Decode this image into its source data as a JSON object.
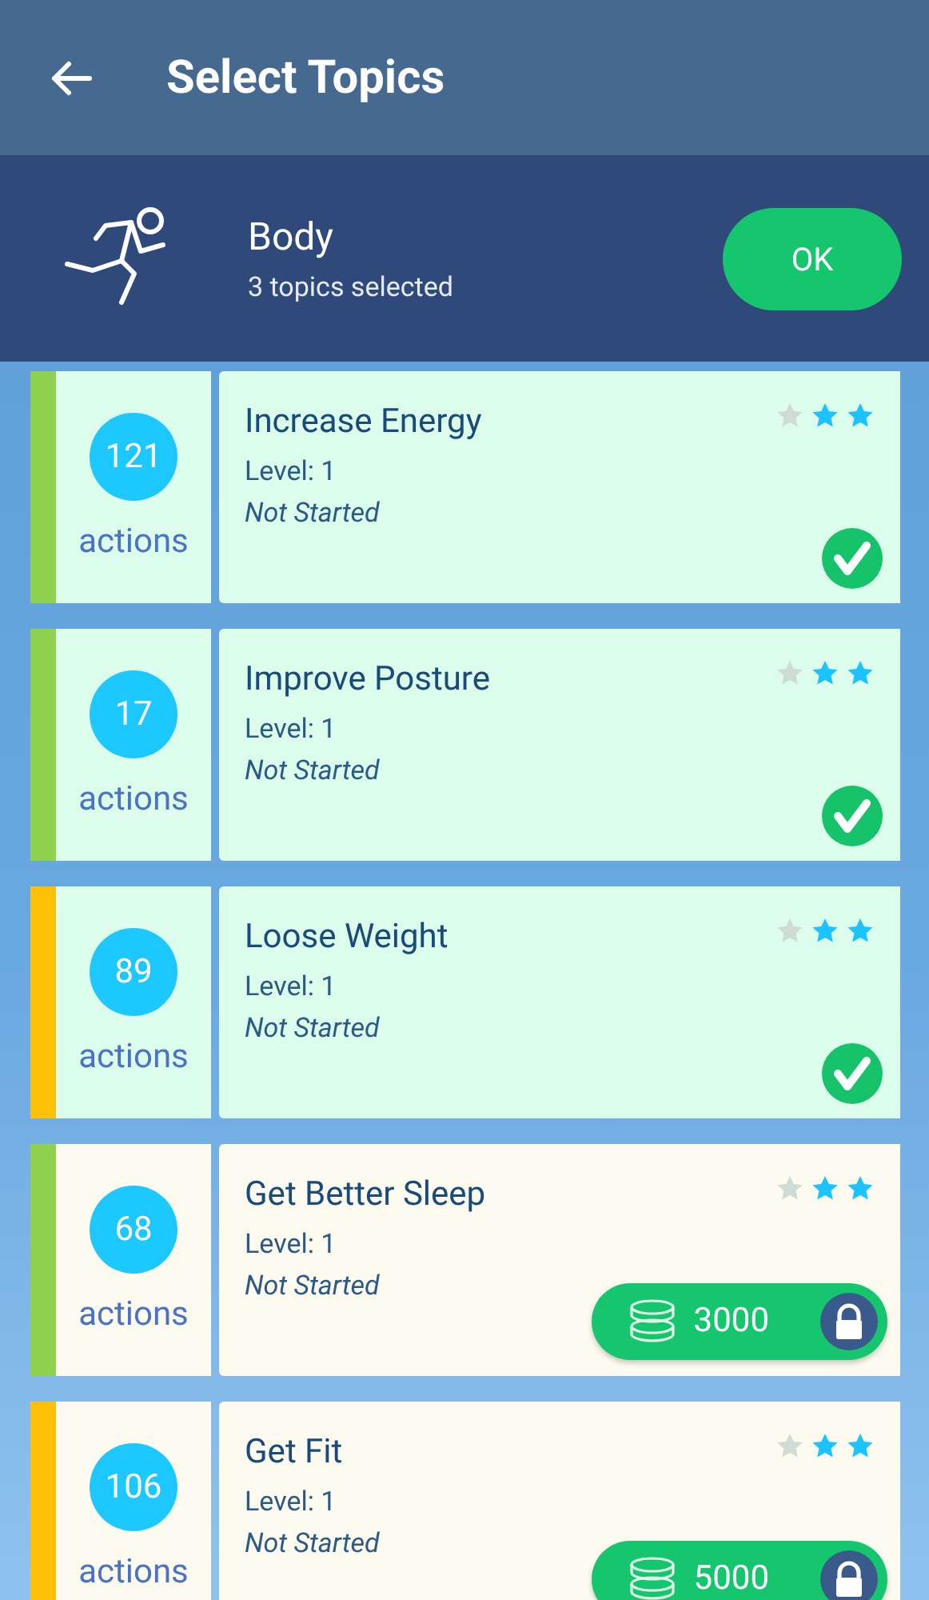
{
  "app_bar": {
    "title": "Select Topics"
  },
  "category": {
    "name": "Body",
    "subtitle": "3 topics selected",
    "button": "OK"
  },
  "topics": [
    {
      "count": "121",
      "count_label": "actions",
      "title": "Increase Energy",
      "level": "Level: 1",
      "status": "Not Started",
      "stars": 2,
      "color": "#8fd14f",
      "kind": "selected"
    },
    {
      "count": "17",
      "count_label": "actions",
      "title": "Improve Posture",
      "level": "Level: 1",
      "status": "Not Started",
      "stars": 2,
      "color": "#8fd14f",
      "kind": "selected"
    },
    {
      "count": "89",
      "count_label": "actions",
      "title": "Loose Weight",
      "level": "Level: 1",
      "status": "Not Started",
      "stars": 2,
      "color": "#ffc107",
      "kind": "selected"
    },
    {
      "count": "68",
      "count_label": "actions",
      "title": "Get Better Sleep",
      "level": "Level: 1",
      "status": "Not Started",
      "stars": 2,
      "color": "#8fd14f",
      "kind": "locked",
      "price": "3000"
    },
    {
      "count": "106",
      "count_label": "actions",
      "title": "Get Fit",
      "level": "Level: 1",
      "status": "Not Started",
      "stars": 2,
      "color": "#ffc107",
      "kind": "locked",
      "price": "5000"
    }
  ]
}
